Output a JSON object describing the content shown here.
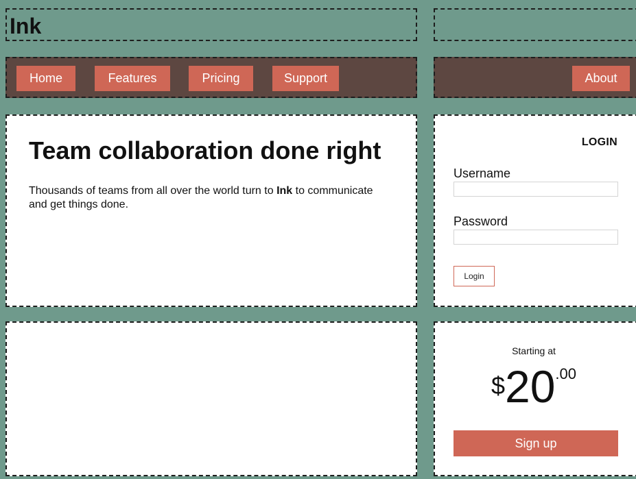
{
  "header": {
    "logo": "Ink"
  },
  "nav": {
    "items": [
      "Home",
      "Features",
      "Pricing",
      "Support"
    ],
    "right_item": "About"
  },
  "hero": {
    "title": "Team collaboration done right",
    "text_before": "Thousands of teams from all over the world turn to ",
    "brand": "Ink",
    "text_after": " to communicate and get things done."
  },
  "login": {
    "title": "LOGIN",
    "username_label": "Username",
    "username_value": "",
    "password_label": "Password",
    "password_value": "",
    "button": "Login"
  },
  "pricing": {
    "caption": "Starting at",
    "currency": "$",
    "amount": "20",
    "cents": ".00",
    "signup_button": "Sign up"
  },
  "colors": {
    "background": "#6f9a8c",
    "nav_bar": "#5d4741",
    "accent": "#cf6756"
  }
}
